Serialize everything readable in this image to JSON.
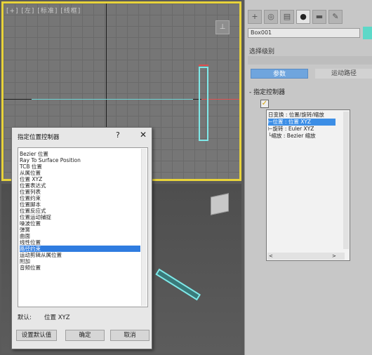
{
  "viewport_top": {
    "label": "[+] [左] [标准] [线框]",
    "nav_glyph": "⊥"
  },
  "command_panel": {
    "tabs": [
      "+",
      "◎",
      "▤",
      "●",
      "▬",
      "✎"
    ],
    "object_name": "Box001",
    "object_color": "#5ed8c8",
    "selection_level_label": "选择级别",
    "tab_params": "参数",
    "tab_motion_path": "运动路径",
    "rollout_title": "- 指定控制器",
    "check_glyph": "✓",
    "tree_rows": [
      "日变换 : 位置/旋转/缩放",
      "   ⊢位置 : 位置 XYZ",
      "   ⊢旋转 : Euler XYZ",
      "   └缩放 : Bezier 缩放"
    ],
    "tree_scroll_left": "<",
    "tree_scroll_right": ">"
  },
  "dialog": {
    "title": "指定位置控制器",
    "help": "?",
    "close": "✕",
    "items": [
      "Bezier 位置",
      "Ray To Surface Position",
      "TCB 位置",
      "从属位置",
      "位置 XYZ",
      "位置表达式",
      "位置列表",
      "位置约束",
      "位置脚本",
      "位置反应式",
      "位置运动捕捉",
      "噪波位置",
      "弹簧",
      "曲面",
      "线性位置",
      "路径约束",
      "运动剪辑从属位置",
      "附加",
      "音频位置"
    ],
    "selected_index": 15,
    "default_label": "默认:",
    "default_value": "位置 XYZ",
    "btn_set_default": "设置默认值",
    "btn_ok": "确定",
    "btn_cancel": "取消"
  }
}
